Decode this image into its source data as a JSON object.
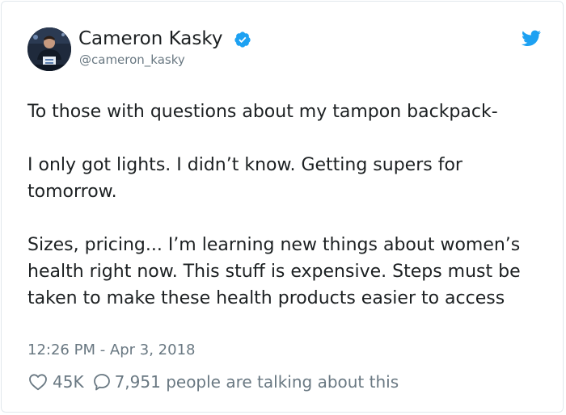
{
  "author": {
    "name": "Cameron Kasky",
    "handle": "@cameron_kasky"
  },
  "tweet": {
    "paragraphs": [
      "To those with questions about my tampon backpack-",
      "I only got lights. I didn’t know. Getting supers for tomorrow.",
      "Sizes, pricing... I’m learning new things about women’s health right now. This stuff is expensive. Steps must be taken to make these health products easier to access"
    ],
    "timestamp": "12:26 PM - Apr 3, 2018"
  },
  "actions": {
    "likes": "45K",
    "talking": "7,951 people are talking about this"
  },
  "icons": {
    "verified": "verified-badge-icon",
    "bird": "twitter-bird-icon",
    "like": "heart-icon",
    "reply": "speech-bubble-icon"
  },
  "colors": {
    "verified": "#1da1f2",
    "bird": "#1da1f2",
    "secondary_text": "#697882"
  }
}
